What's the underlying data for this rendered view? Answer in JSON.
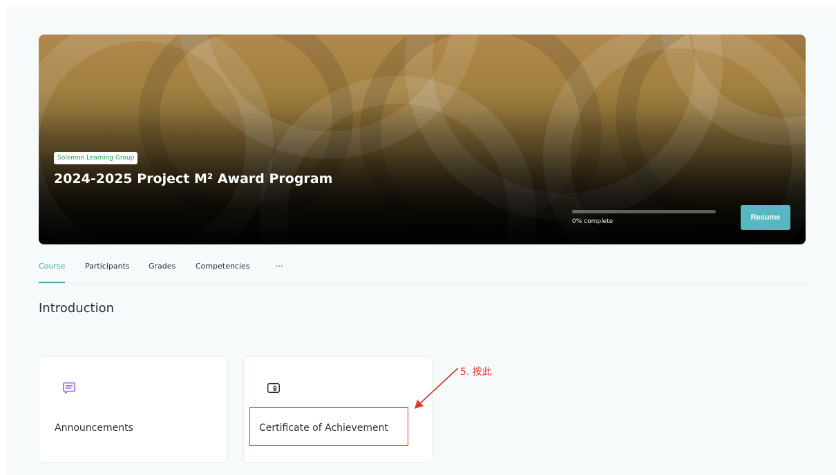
{
  "hero": {
    "organization": "Solomon Learning Group",
    "course_title": "2024-2025 Project M² Award Program",
    "progress": {
      "percent": 0,
      "label": "0% complete"
    },
    "resume_label": "Resume"
  },
  "tabs": [
    {
      "label": "Course",
      "active": true
    },
    {
      "label": "Participants",
      "active": false
    },
    {
      "label": "Grades",
      "active": false
    },
    {
      "label": "Competencies",
      "active": false
    },
    {
      "label": "···",
      "active": false
    }
  ],
  "section": {
    "title": "Introduction"
  },
  "cards": [
    {
      "title": "Announcements",
      "icon": "chat-lines-icon"
    },
    {
      "title": "Certificate of Achievement",
      "icon": "certificate-icon"
    }
  ],
  "annotation": {
    "text": "5. 按此"
  },
  "colors": {
    "accent": "#4aa8b2",
    "resume_button": "#58b7c0",
    "badge_text": "#22a34a",
    "announcement_icon": "#8b5cf6",
    "annotation_red": "#e5362a"
  }
}
